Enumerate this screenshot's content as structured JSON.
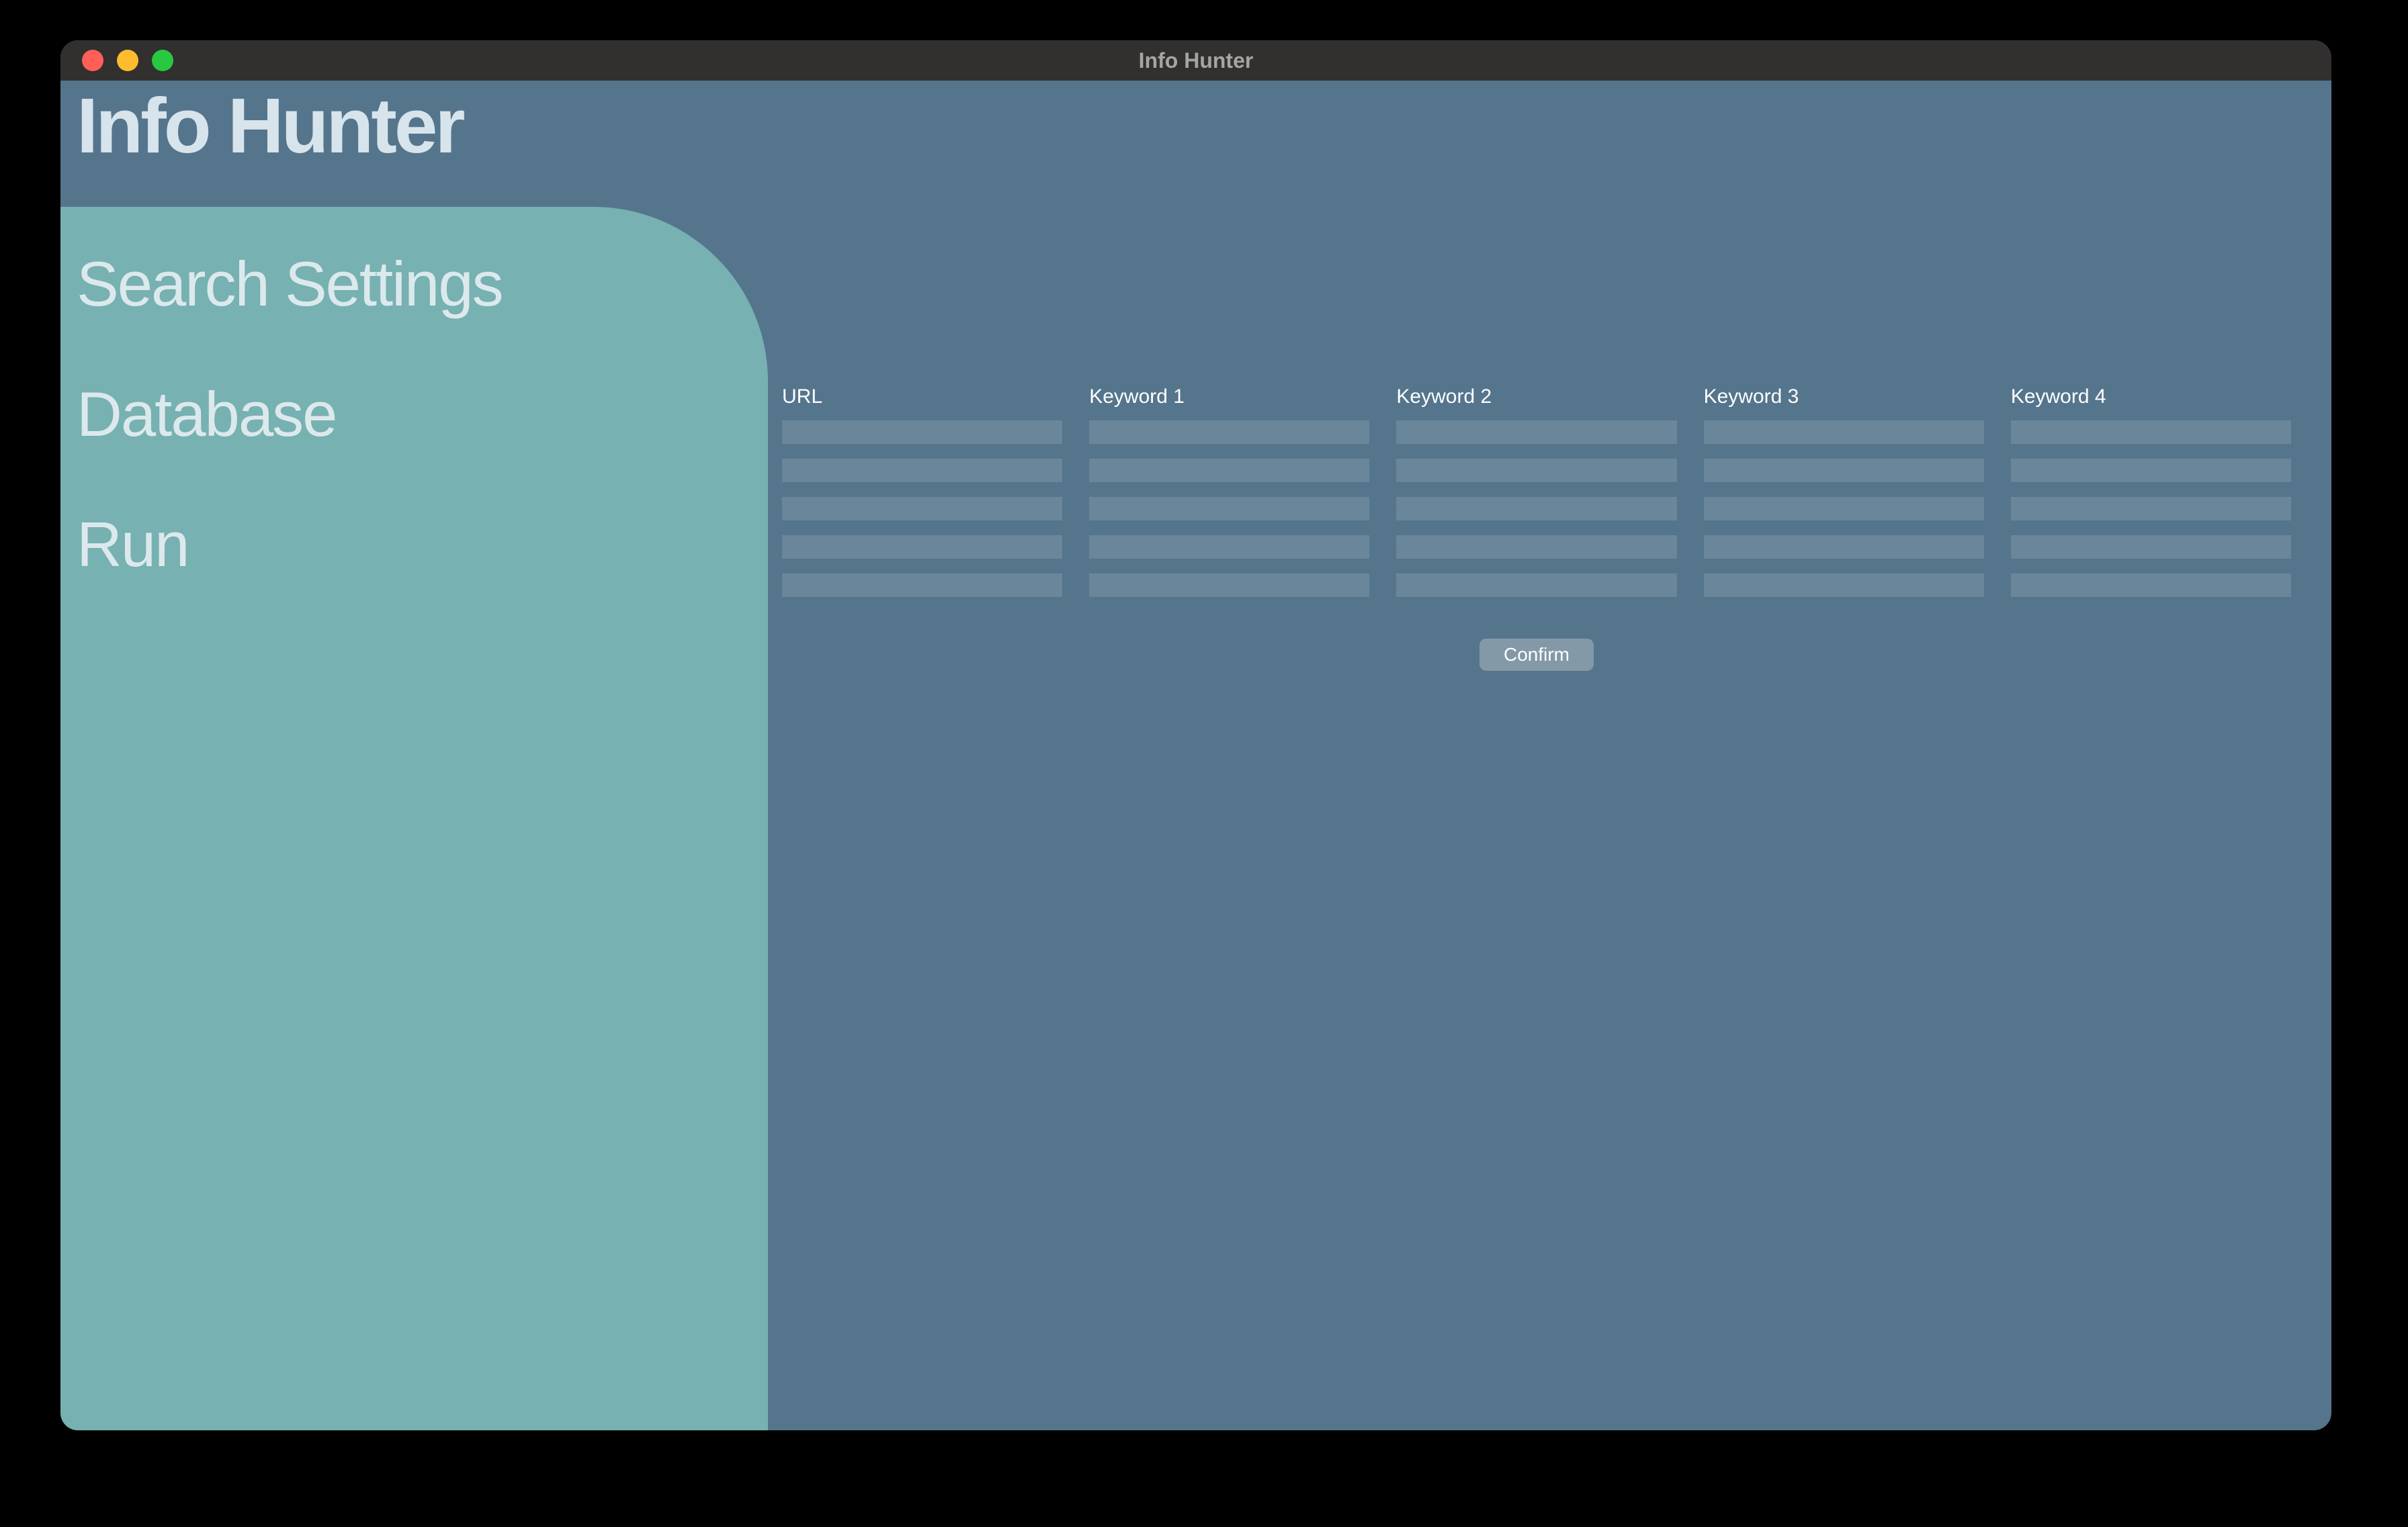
{
  "window": {
    "title": "Info Hunter"
  },
  "app": {
    "title": "Info Hunter"
  },
  "sidebar": {
    "items": [
      {
        "label": "Search Settings"
      },
      {
        "label": "Database"
      },
      {
        "label": "Run"
      }
    ]
  },
  "form": {
    "columns": [
      {
        "label": "URL"
      },
      {
        "label": "Keyword 1"
      },
      {
        "label": "Keyword 2"
      },
      {
        "label": "Keyword 3"
      },
      {
        "label": "Keyword 4"
      }
    ],
    "row_count": 5,
    "confirm_label": "Confirm"
  }
}
